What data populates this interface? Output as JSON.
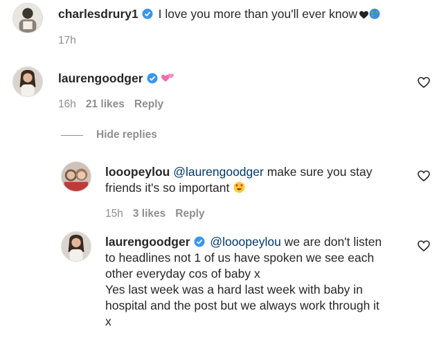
{
  "comments": [
    {
      "username": "charlesdrury1",
      "text": "I love you more than you'll ever know",
      "emoji": [
        "black-heart",
        "globe"
      ],
      "time": "17h"
    },
    {
      "username": "laurengoodger",
      "emoji": [
        "two-hearts"
      ],
      "time": "16h",
      "likes": "21 likes",
      "reply_label": "Reply"
    }
  ],
  "hide_replies_label": "Hide replies",
  "replies": [
    {
      "username": "looopeylou",
      "mention": "@laurengoodger",
      "text_line1": " make sure you stay",
      "text_line2": "friends it's so important",
      "emoji": [
        "heart-eyes"
      ],
      "time": "15h",
      "likes": "3 likes",
      "reply_label": "Reply"
    },
    {
      "username": "laurengoodger",
      "mention": "@looopeylou",
      "text_line1": " we are don't listen",
      "text_line2": "to headlines not 1 of us have spoken we see each",
      "text_line3": "other everyday cos of baby x",
      "text_line4": "Yes last week was a hard last week with baby in",
      "text_line5": "hospital and the post but we always work through it",
      "text_line6": "x"
    }
  ],
  "colors": {
    "text": "#262626",
    "secondary": "#8e8e8e",
    "mention": "#00376b",
    "verified": "#3897f0"
  }
}
